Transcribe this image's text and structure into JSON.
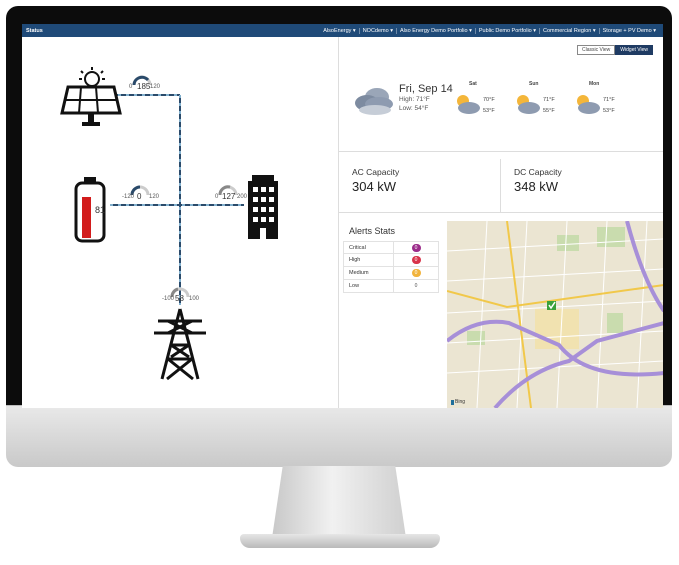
{
  "topbar": {
    "title": "Status",
    "nav": [
      "AlsoEnergy",
      "NOCdemo",
      "Also Energy Demo Portfolio",
      "Public Demo Portfolio",
      "Commercial Region",
      "Storage + PV Demo"
    ]
  },
  "view_toggle": {
    "classic": "Classic View",
    "widget": "Widget View",
    "active": "widget"
  },
  "flow": {
    "solar": {
      "value": "185",
      "min": "0",
      "max": "120"
    },
    "battery": {
      "value": "0",
      "min": "-120",
      "max": "120",
      "percent": "81"
    },
    "building": {
      "value": "127",
      "min": "0",
      "max": "200"
    },
    "grid": {
      "value": "58",
      "min": "-100",
      "max": "100"
    }
  },
  "weather": {
    "today": {
      "date": "Fri, Sep 14",
      "high": "High: 71°F",
      "low": "Low: 54°F"
    },
    "forecast": [
      {
        "day": "Sat",
        "high": "70°F",
        "low": "53°F"
      },
      {
        "day": "Sun",
        "high": "71°F",
        "low": "55°F"
      },
      {
        "day": "Mon",
        "high": "71°F",
        "low": "53°F"
      }
    ]
  },
  "capacity": {
    "ac": {
      "label": "AC Capacity",
      "value": "304 kW"
    },
    "dc": {
      "label": "DC Capacity",
      "value": "348 kW"
    }
  },
  "alerts": {
    "title": "Alerts Stats",
    "rows": [
      {
        "name": "Critical",
        "count": "0",
        "color": "#9b2c8a"
      },
      {
        "name": "High",
        "count": "0",
        "color": "#d8334a"
      },
      {
        "name": "Medium",
        "count": "0",
        "color": "#f1b33c"
      },
      {
        "name": "Low",
        "count": "0",
        "color": "#ffffff"
      }
    ]
  },
  "map": {
    "attribution": "Bing"
  },
  "colors": {
    "nav_bar": "#1f4a78",
    "flow_line": "#2a4a6a",
    "battery_fill": "#d21c1c",
    "map_road": "#a78fd8"
  }
}
